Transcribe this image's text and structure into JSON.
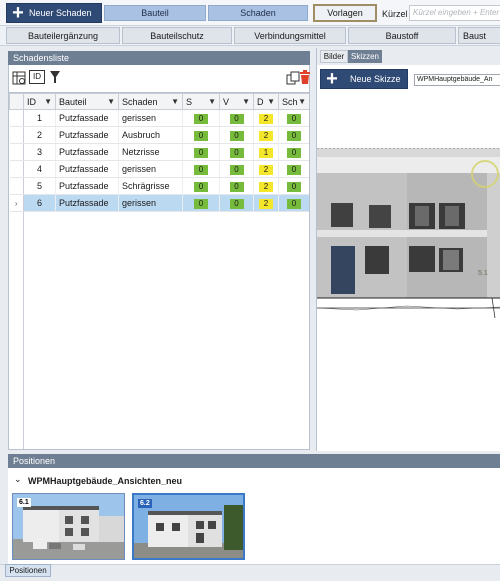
{
  "toolbar": {
    "new_damage_label": "Neuer Schaden",
    "tab_component": "Bauteil",
    "tab_damage": "Schaden",
    "templates_label": "Vorlagen",
    "shortcut_label": "Kürzel",
    "shortcut_placeholder": "Kürzel eingeben + Enter"
  },
  "toolbar2": [
    "Bauteilergänzung",
    "Bauteilschutz",
    "Verbindungsmittel",
    "Baustoff",
    "Baust"
  ],
  "damage_list": {
    "title": "Schadensliste",
    "columns": [
      "ID",
      "Bauteil",
      "Schaden",
      "S",
      "V",
      "D",
      "Sch"
    ],
    "rows": [
      {
        "id": "1",
        "component": "Putzfassade",
        "damage": "gerissen",
        "s": "0",
        "v": "0",
        "d": "2",
        "sch": "0"
      },
      {
        "id": "2",
        "component": "Putzfassade",
        "damage": "Ausbruch",
        "s": "0",
        "v": "0",
        "d": "2",
        "sch": "0"
      },
      {
        "id": "3",
        "component": "Putzfassade",
        "damage": "Netzrisse",
        "s": "0",
        "v": "0",
        "d": "1",
        "sch": "0"
      },
      {
        "id": "4",
        "component": "Putzfassade",
        "damage": "gerissen",
        "s": "0",
        "v": "0",
        "d": "2",
        "sch": "0"
      },
      {
        "id": "5",
        "component": "Putzfassade",
        "damage": "Schrägrisse",
        "s": "0",
        "v": "0",
        "d": "2",
        "sch": "0"
      },
      {
        "id": "6",
        "component": "Putzfassade",
        "damage": "gerissen",
        "s": "0",
        "v": "0",
        "d": "2",
        "sch": "0"
      }
    ],
    "selected_row": "6"
  },
  "right_panel": {
    "tab_images": "Bilder",
    "tab_sketches": "Skizzen",
    "new_sketch_label": "Neue Skizze",
    "file_name": "WPMHauptgebäude_An",
    "marker_label": "5.1"
  },
  "positions": {
    "title": "Positionen",
    "group_label": "WPMHauptgebäude_Ansichten_neu",
    "thumbs": [
      {
        "label": "6.1"
      },
      {
        "label": "6.2"
      }
    ],
    "footer_tab": "Positionen"
  },
  "colors": {
    "dark_blue": "#2f4a75",
    "light_blue": "#a9c1e2",
    "green_badge": "#77bb3c",
    "yellow_badge": "#f4e62a",
    "selection": "#bcd9f2"
  }
}
